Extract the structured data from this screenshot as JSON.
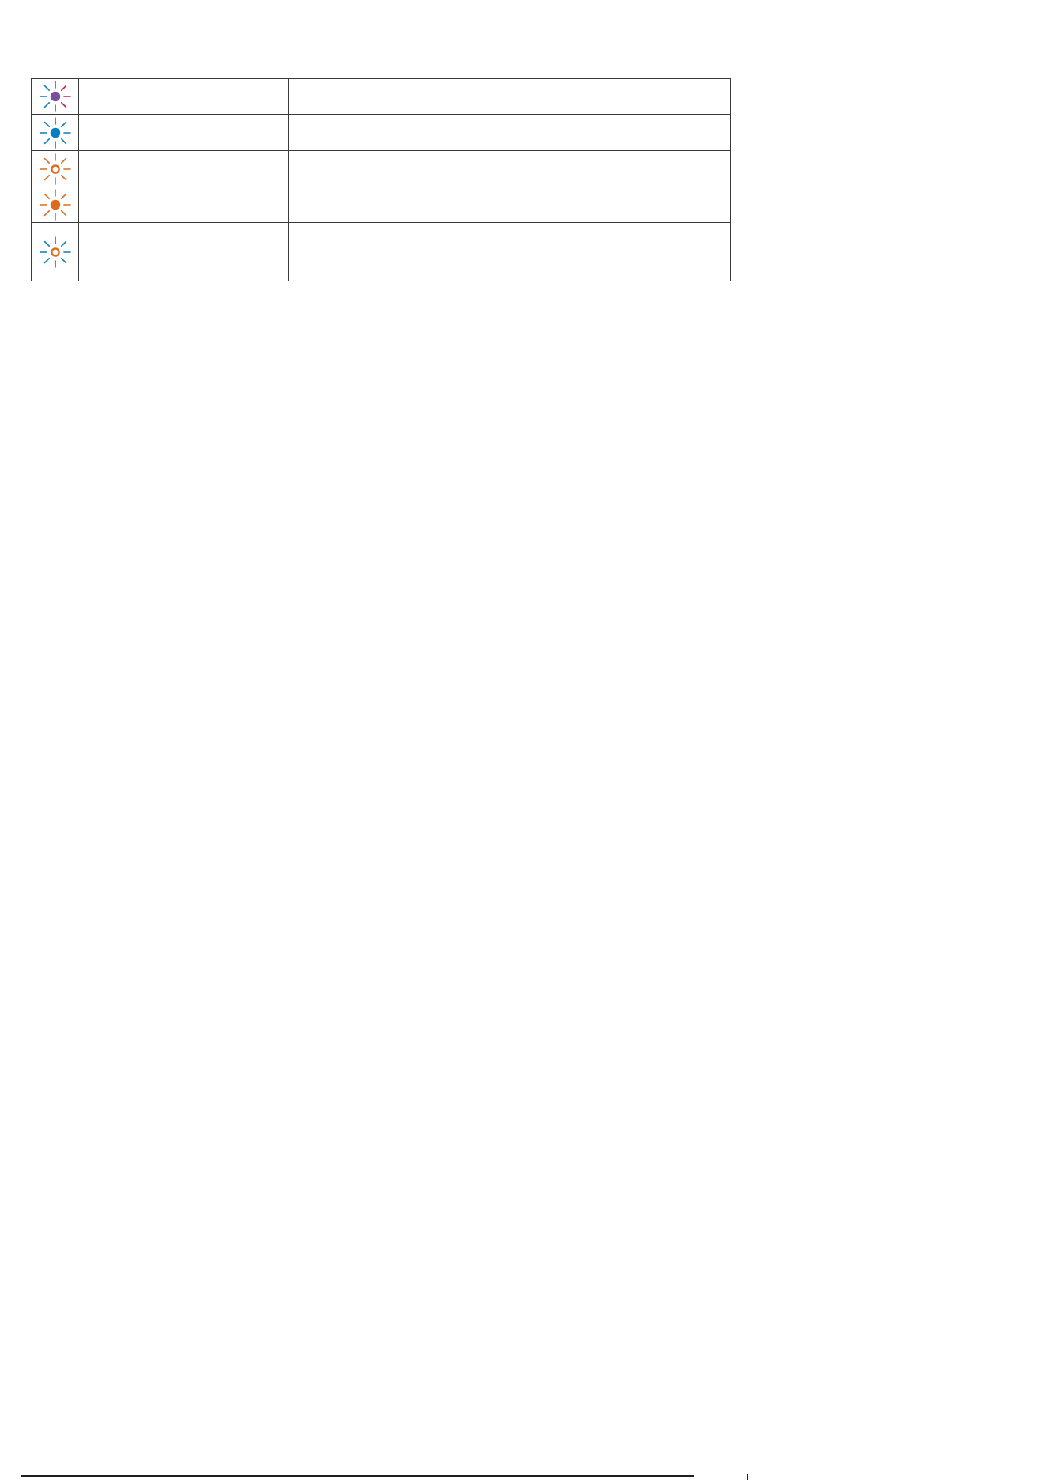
{
  "indicators": [
    {
      "icon": "blinking-purple-light-icon",
      "center": "#7b4f9e",
      "rays_left": "#0a7cc1",
      "rays_right": "#c2185b",
      "fill": "solid",
      "state": "",
      "description": ""
    },
    {
      "icon": "blinking-blue-light-icon",
      "center": "#0a7cc1",
      "rays_left": "#0a7cc1",
      "rays_right": "#0a7cc1",
      "fill": "solid",
      "state": "",
      "description": ""
    },
    {
      "icon": "blinking-orange-ring-light-icon",
      "center": "#e06a1b",
      "rays_left": "#e06a1b",
      "rays_right": "#e06a1b",
      "fill": "ring",
      "state": "",
      "description": ""
    },
    {
      "icon": "blinking-orange-light-icon",
      "center": "#e06a1b",
      "rays_left": "#e06a1b",
      "rays_right": "#e06a1b",
      "fill": "solid",
      "state": "",
      "description": ""
    },
    {
      "icon": "alternating-blue-orange-light-icon",
      "center": "#e06a1b",
      "rays_left": "#0a7cc1",
      "rays_right": "#0a7cc1",
      "fill": "ring",
      "state": "",
      "description": ""
    }
  ]
}
